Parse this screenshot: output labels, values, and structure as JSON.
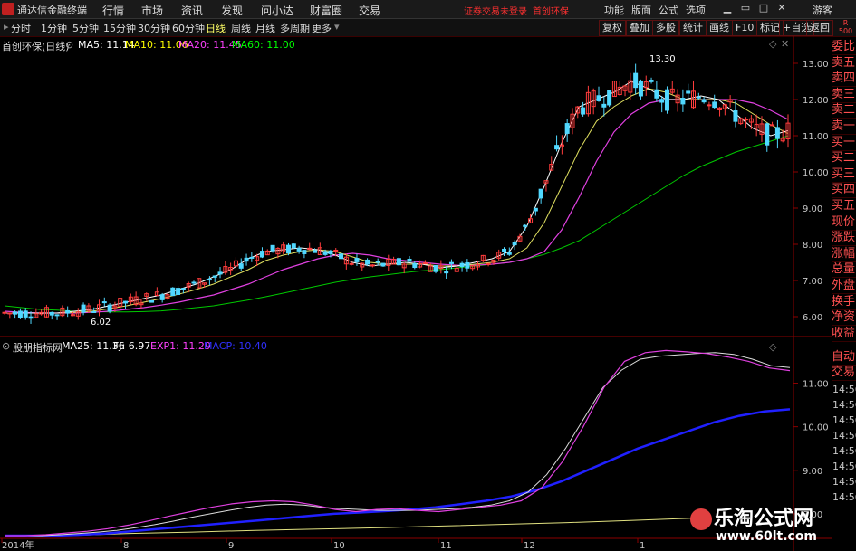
{
  "app": {
    "title": "通达信金融终端"
  },
  "menu": [
    "行情",
    "市场",
    "资讯",
    "发现",
    "问小达",
    "财富圈",
    "交易"
  ],
  "warning": "证券交易未登录",
  "stock_link": "首创环保",
  "right_menu": [
    "功能",
    "版面",
    "公式",
    "选项"
  ],
  "guest": "游客",
  "periods": [
    "分时",
    "1分钟",
    "5分钟",
    "15分钟",
    "30分钟",
    "60分钟",
    "日线",
    "周线",
    "月线",
    "多周期",
    "更多"
  ],
  "active_period": "日线",
  "right_tools": [
    "复权",
    "叠加",
    "多股",
    "统计",
    "画线",
    "F10",
    "标记",
    "+自选",
    "返回"
  ],
  "rs_label": "R",
  "rs_num": "500",
  "main_chart": {
    "name": "首创环保(日线)",
    "ma": [
      {
        "label": "MA5: 11.14",
        "color": "#ffffff"
      },
      {
        "label": "MA10: 11.06",
        "color": "#ffff00"
      },
      {
        "label": "MA20: 11.45",
        "color": "#ff40ff"
      },
      {
        "label": "MA60: 11.00",
        "color": "#00ff00"
      }
    ],
    "y_ticks": [
      "13.00",
      "12.00",
      "11.00",
      "10.00",
      "9.00",
      "8.00",
      "7.00",
      "6.00"
    ],
    "high_label": "13.30",
    "low_label": "6.02"
  },
  "sub_chart": {
    "name": "股朋指标网",
    "lines": [
      {
        "label": "MA25: 11.36",
        "color": "#ffffff"
      },
      {
        "label": "FJ: 6.97",
        "color": "#ffffff"
      },
      {
        "label": "EXP1: 11.29",
        "color": "#ff40ff"
      },
      {
        "label": "MACP: 10.40",
        "color": "#3030ff"
      }
    ],
    "y_ticks": [
      "11.00",
      "10.00",
      "9.00",
      "8.00"
    ]
  },
  "x_labels": [
    "2014年",
    "8",
    "9",
    "10",
    "11",
    "12",
    "1"
  ],
  "side_buttons": [
    "委比",
    "卖五",
    "卖四",
    "卖三",
    "卖二",
    "卖一",
    "买一",
    "买二",
    "买三",
    "买四",
    "买五",
    "现价",
    "涨跌",
    "涨幅",
    "总量",
    "外盘",
    "换手",
    "净资",
    "收益"
  ],
  "side_buttons_lower": [
    "自动",
    "交易"
  ],
  "side_times": [
    "14:56",
    "14:56",
    "14:56",
    "14:56",
    "14:56",
    "14:56",
    "14:56",
    "14:56"
  ],
  "watermark": {
    "title": "乐淘公式网",
    "url": "www.60lt.com"
  },
  "chart_data": {
    "type": "candlestick",
    "title": "首创环保(日线)",
    "ylim": [
      5.7,
      13.5
    ],
    "y_ticks": [
      6,
      7,
      8,
      9,
      10,
      11,
      12,
      13
    ],
    "x_months": [
      "2014年",
      "8",
      "9",
      "10",
      "11",
      "12",
      "1"
    ],
    "ma5": [
      6.1,
      6.1,
      6.1,
      6.1,
      6.15,
      6.2,
      6.3,
      6.4,
      6.5,
      6.6,
      6.75,
      6.9,
      7.1,
      7.3,
      7.6,
      7.8,
      7.85,
      7.9,
      7.85,
      7.7,
      7.5,
      7.4,
      7.45,
      7.5,
      7.45,
      7.35,
      7.4,
      7.5,
      7.6,
      7.8,
      8.5,
      9.6,
      10.8,
      11.8,
      12.0,
      12.2,
      12.5,
      12.3,
      12.0,
      12.0,
      12.1,
      12.0,
      11.6,
      11.2,
      11.0,
      11.14
    ],
    "ma10": [
      6.1,
      6.1,
      6.1,
      6.1,
      6.12,
      6.15,
      6.22,
      6.3,
      6.4,
      6.5,
      6.62,
      6.75,
      6.9,
      7.1,
      7.3,
      7.55,
      7.7,
      7.8,
      7.85,
      7.8,
      7.65,
      7.5,
      7.45,
      7.45,
      7.45,
      7.4,
      7.4,
      7.45,
      7.5,
      7.6,
      7.9,
      8.6,
      9.6,
      10.6,
      11.4,
      11.8,
      12.1,
      12.3,
      12.2,
      12.0,
      12.0,
      12.0,
      11.9,
      11.6,
      11.3,
      11.06
    ],
    "ma20": [
      6.15,
      6.12,
      6.1,
      6.1,
      6.1,
      6.12,
      6.15,
      6.2,
      6.25,
      6.32,
      6.4,
      6.5,
      6.6,
      6.75,
      6.9,
      7.1,
      7.3,
      7.45,
      7.6,
      7.7,
      7.75,
      7.7,
      7.6,
      7.55,
      7.5,
      7.45,
      7.42,
      7.42,
      7.45,
      7.5,
      7.6,
      7.8,
      8.4,
      9.3,
      10.3,
      11.1,
      11.6,
      11.9,
      12.0,
      12.0,
      12.0,
      12.0,
      12.0,
      11.9,
      11.7,
      11.45
    ],
    "ma60": [
      6.3,
      6.25,
      6.2,
      6.18,
      6.15,
      6.14,
      6.13,
      6.13,
      6.14,
      6.16,
      6.2,
      6.25,
      6.3,
      6.38,
      6.46,
      6.55,
      6.65,
      6.75,
      6.85,
      6.95,
      7.03,
      7.1,
      7.16,
      7.22,
      7.27,
      7.3,
      7.35,
      7.4,
      7.45,
      7.5,
      7.6,
      7.72,
      7.9,
      8.1,
      8.4,
      8.7,
      9.0,
      9.3,
      9.6,
      9.9,
      10.15,
      10.35,
      10.55,
      10.7,
      10.85,
      11.0
    ],
    "sub_lines": {
      "ylim": [
        7.5,
        11.8
      ],
      "ma25": [
        7.5,
        7.5,
        7.5,
        7.52,
        7.55,
        7.58,
        7.62,
        7.68,
        7.75,
        7.83,
        7.92,
        8.0,
        8.08,
        8.15,
        8.2,
        8.22,
        8.2,
        8.15,
        8.12,
        8.1,
        8.08,
        8.08,
        8.08,
        8.1,
        8.12,
        8.15,
        8.2,
        8.3,
        8.5,
        8.9,
        9.5,
        10.2,
        10.9,
        11.3,
        11.55,
        11.62,
        11.65,
        11.68,
        11.7,
        11.66,
        11.55,
        11.4,
        11.36
      ],
      "exp1": [
        7.5,
        7.5,
        7.52,
        7.56,
        7.6,
        7.66,
        7.74,
        7.84,
        7.95,
        8.05,
        8.15,
        8.23,
        8.28,
        8.3,
        8.28,
        8.2,
        8.1,
        8.05,
        8.1,
        8.12,
        8.08,
        8.05,
        8.1,
        8.15,
        8.2,
        8.3,
        8.6,
        9.2,
        10.0,
        10.9,
        11.5,
        11.7,
        11.75,
        11.72,
        11.68,
        11.6,
        11.5,
        11.35,
        11.29
      ],
      "macp": [
        7.5,
        7.5,
        7.5,
        7.52,
        7.55,
        7.6,
        7.65,
        7.7,
        7.75,
        7.8,
        7.85,
        7.9,
        7.95,
        8.0,
        8.03,
        8.06,
        8.1,
        8.15,
        8.22,
        8.3,
        8.4,
        8.55,
        8.75,
        9.0,
        9.25,
        9.5,
        9.7,
        9.9,
        10.1,
        10.25,
        10.35,
        10.4
      ],
      "fj": [
        7.5,
        7.5,
        7.55,
        7.58,
        7.62,
        7.65,
        7.68,
        7.72,
        7.76,
        7.8,
        7.85,
        7.9
      ]
    }
  }
}
